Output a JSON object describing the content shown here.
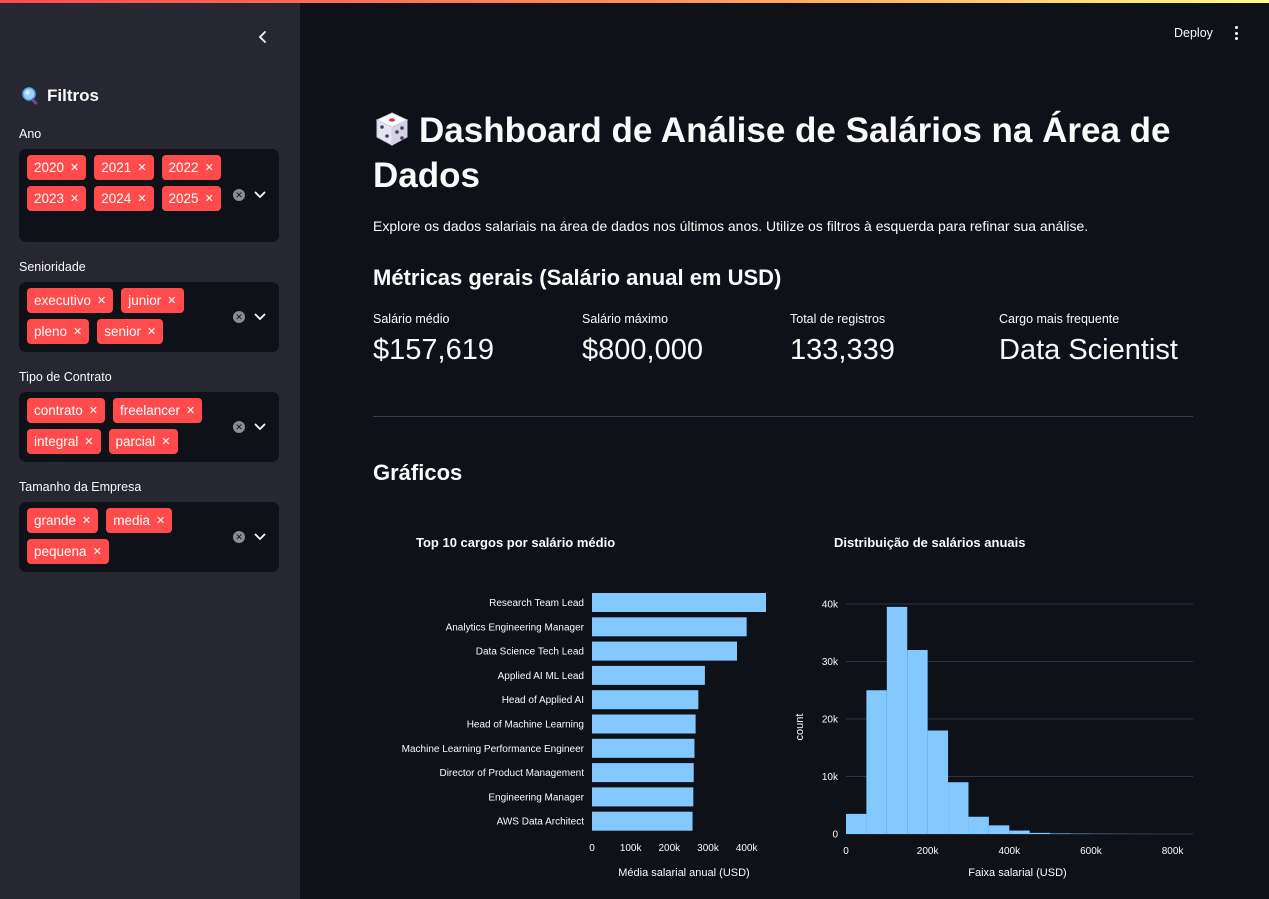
{
  "sidebar": {
    "title": "Filtros",
    "filters": [
      {
        "label": "Ano",
        "chips": [
          "2020",
          "2021",
          "2022",
          "2023",
          "2024",
          "2025"
        ]
      },
      {
        "label": "Senioridade",
        "chips": [
          "executivo",
          "junior",
          "pleno",
          "senior"
        ]
      },
      {
        "label": "Tipo de Contrato",
        "chips": [
          "contrato",
          "freelancer",
          "integral",
          "parcial"
        ]
      },
      {
        "label": "Tamanho da Empresa",
        "chips": [
          "grande",
          "media",
          "pequena"
        ]
      }
    ]
  },
  "header": {
    "deploy_label": "Deploy"
  },
  "main": {
    "title": "Dashboard de Análise de Salários na Área de Dados",
    "subtitle": "Explore os dados salariais na área de dados nos últimos anos. Utilize os filtros à esquerda para refinar sua análise.",
    "metrics_heading": "Métricas gerais (Salário anual em USD)",
    "metrics": [
      {
        "label": "Salário médio",
        "value": "$157,619"
      },
      {
        "label": "Salário máximo",
        "value": "$800,000"
      },
      {
        "label": "Total de registros",
        "value": "133,339"
      },
      {
        "label": "Cargo mais frequente",
        "value": "Data Scientist"
      }
    ],
    "charts_heading": "Gráficos"
  },
  "colors": {
    "accent": "#ff4b4b",
    "bar": "#83c9ff",
    "bg": "#0e1117",
    "sidebar": "#262730"
  },
  "chart_data": [
    {
      "type": "bar",
      "orientation": "horizontal",
      "title": "Top 10 cargos por salário médio",
      "xlabel": "Média salarial anual (USD)",
      "ylabel": "",
      "categories": [
        "Research Team Lead",
        "Analytics Engineering Manager",
        "Data Science Tech Lead",
        "Applied AI ML Lead",
        "Head of Applied AI",
        "Head of Machine Learning",
        "Machine Learning Performance Engineer",
        "Director of Product Management",
        "Engineering Manager",
        "AWS Data Architect"
      ],
      "values": [
        450000,
        400000,
        375000,
        292000,
        275000,
        268000,
        265000,
        263000,
        262000,
        260000
      ],
      "xlim": [
        0,
        450000
      ],
      "xticks": [
        0,
        100000,
        200000,
        300000,
        400000
      ],
      "xtick_labels": [
        "0",
        "100k",
        "200k",
        "300k",
        "400k"
      ],
      "grid": false
    },
    {
      "type": "bar",
      "subtype": "histogram",
      "title": "Distribuição de salários anuais",
      "xlabel": "Faixa salarial (USD)",
      "ylabel": "count",
      "bin_width": 50000,
      "bins_start": [
        0,
        50000,
        100000,
        150000,
        200000,
        250000,
        300000,
        350000,
        400000,
        450000,
        500000,
        550000,
        600000,
        650000,
        700000,
        750000,
        800000
      ],
      "values": [
        3500,
        25000,
        39500,
        32000,
        18000,
        9000,
        3000,
        1500,
        600,
        200,
        100,
        60,
        40,
        20,
        10,
        5,
        5
      ],
      "xlim": [
        0,
        850000
      ],
      "ylim": [
        0,
        40000
      ],
      "xticks": [
        0,
        200000,
        400000,
        600000,
        800000
      ],
      "xtick_labels": [
        "0",
        "200k",
        "400k",
        "600k",
        "800k"
      ],
      "yticks": [
        0,
        10000,
        20000,
        30000,
        40000
      ],
      "ytick_labels": [
        "0",
        "10k",
        "20k",
        "30k",
        "40k"
      ],
      "grid": true
    }
  ]
}
